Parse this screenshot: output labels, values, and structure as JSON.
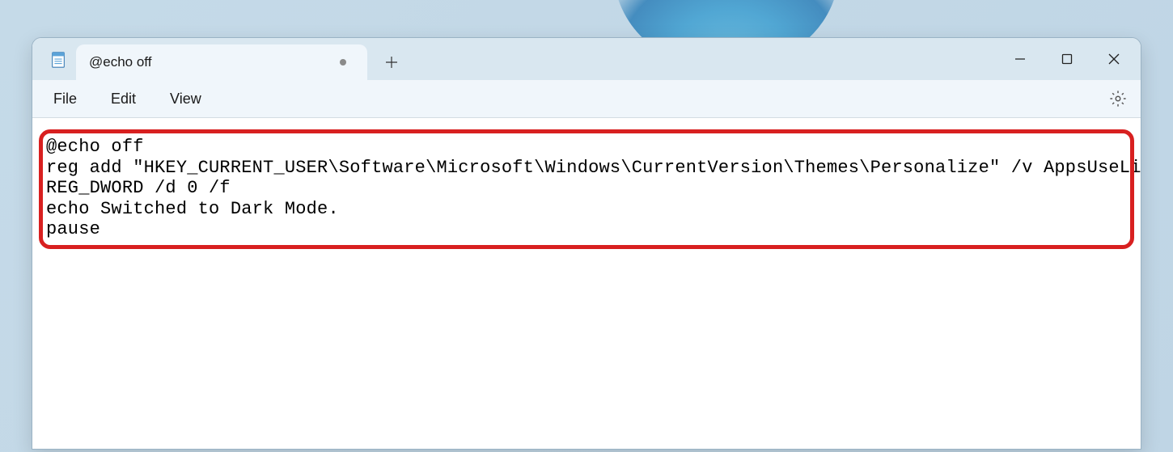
{
  "tab": {
    "title": "@echo off",
    "modified": true
  },
  "menus": {
    "file": "File",
    "edit": "Edit",
    "view": "View"
  },
  "editor": {
    "content": "@echo off\nreg add \"HKEY_CURRENT_USER\\Software\\Microsoft\\Windows\\CurrentVersion\\Themes\\Personalize\" /v AppsUseLightTheme /t \nREG_DWORD /d 0 /f\necho Switched to Dark Mode.\npause"
  }
}
